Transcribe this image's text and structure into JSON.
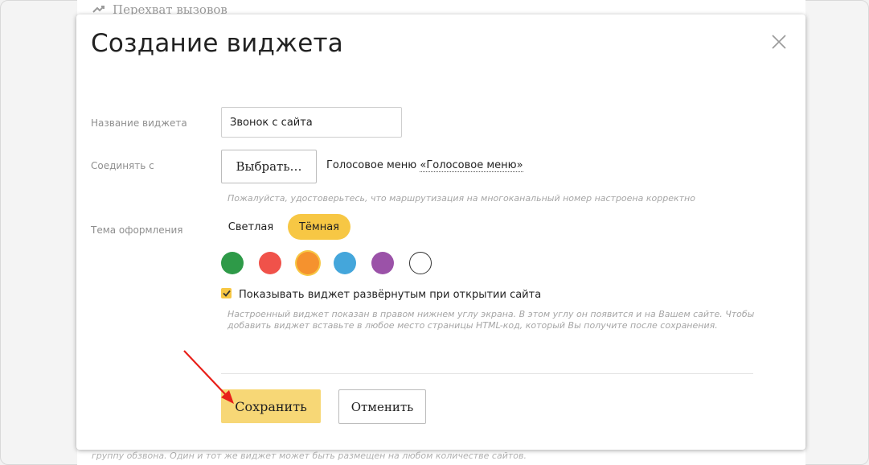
{
  "background": {
    "top_text": "Перехват вызовов",
    "bottom_text": "группу обзвона. Один и тот же виджет может быть размещен на любом количестве сайтов.",
    "top_icon": "call-pickup-icon"
  },
  "modal": {
    "title": "Создание виджета",
    "close_icon": "close-icon",
    "widget_name": {
      "label": "Название виджета",
      "value": "Звонок с сайта"
    },
    "connect": {
      "label": "Соединять с",
      "button_label": "Выбрать…",
      "target_prefix": "Голосовое меню",
      "target_link": "«Голосовое меню»",
      "hint": "Пожалуйста, удостоверьтесь, что маршрутизация на многоканальный номер настроена корректно"
    },
    "theme": {
      "label": "Тема оформления",
      "options": [
        {
          "label": "Светлая",
          "active": false
        },
        {
          "label": "Тёмная",
          "active": true
        }
      ],
      "colors": [
        {
          "name": "green",
          "hex": "#2e9a48",
          "selected": false
        },
        {
          "name": "red",
          "hex": "#f0524a",
          "selected": false
        },
        {
          "name": "orange",
          "hex": "#f5922e",
          "selected": true
        },
        {
          "name": "blue",
          "hex": "#44a6db",
          "selected": false
        },
        {
          "name": "purple",
          "hex": "#9b52a8",
          "selected": false
        },
        {
          "name": "white",
          "hex": "#ffffff",
          "selected": false
        }
      ]
    },
    "expanded": {
      "checked": true,
      "label": "Показывать виджет развёрнутым при открытии сайта",
      "hint_line1": "Настроенный виджет показан в правом нижнем углу экрана. В этом углу он появится и на Вашем сайте. Чтобы",
      "hint_line2": "добавить виджет вставьте в любое место страницы HTML-код, который Вы получите после сохранения."
    },
    "actions": {
      "save_label": "Сохранить",
      "cancel_label": "Отменить"
    },
    "accent_color": "#f7c744"
  }
}
